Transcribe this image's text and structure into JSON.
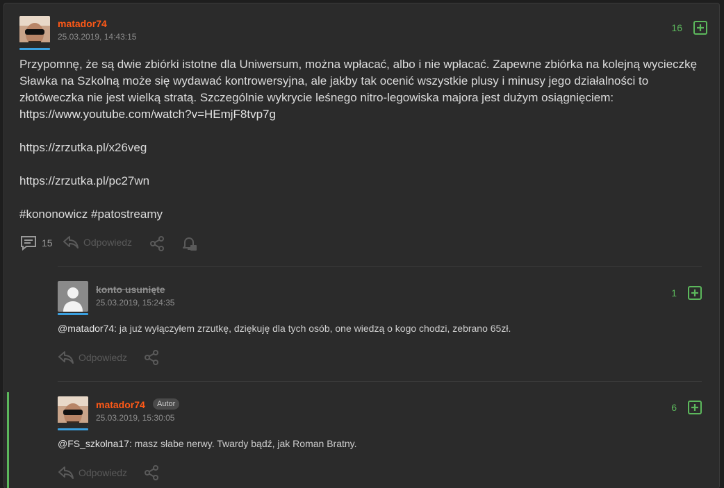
{
  "post": {
    "author": "matador74",
    "date": "25.03.2019, 14:43:15",
    "votes": "16",
    "paragraph1": "Przypomnę, że są dwie zbiórki istotne dla Uniwersum, można wpłacać, albo i nie wpłacać. Zapewne zbiórka na kolejną wycieczkę Sławka na Szkolną może się wydawać kontrowersyjna, ale jakby tak ocenić wszystkie plusy i minusy jego działalności to złotóweczka nie jest wielką stratą. Szczególnie wykrycie leśnego nitro-legowiska majora jest dużym osiągnięciem: ",
    "youtube_link": "https://www.youtube.com/watch?v=HEmjF8tvp7g",
    "link1": "https://zrzutka.pl/x26veg",
    "link2": "https://zrzutka.pl/pc27wn",
    "tags": "#kononowicz #patostreamy",
    "comment_count": "15",
    "reply_label": "Odpowiedz"
  },
  "comments": [
    {
      "author": "konto usunięte",
      "date": "25.03.2019, 15:24:35",
      "votes": "1",
      "mention": "@matador74",
      "text": ": ja już wyłączyłem zrzutkę, dziękuję dla tych osób, one wiedzą o kogo chodzi, zebrano 65zł.",
      "reply_label": "Odpowiedz"
    },
    {
      "author": "matador74",
      "badge": "Autor",
      "date": "25.03.2019, 15:30:05",
      "votes": "6",
      "mention": "@FS_szkolna17",
      "text": ": masz słabe nerwy. Twardy bądź, jak Roman Bratny.",
      "reply_label": "Odpowiedz"
    }
  ],
  "colors": {
    "accent_orange": "#ff5917",
    "vote_green": "#5cb85c",
    "background": "#2b2b2b"
  },
  "icons": [
    "comments-icon",
    "reply-icon",
    "share-icon",
    "notification-icon",
    "plus-icon"
  ]
}
